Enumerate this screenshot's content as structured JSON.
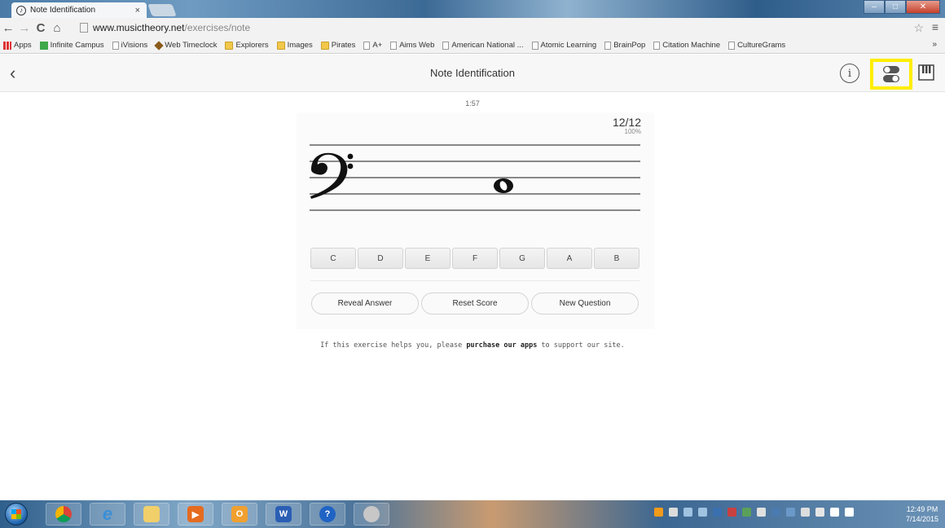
{
  "browser": {
    "tab_title": "Note Identification",
    "tab_close": "×",
    "url_host": "www.musictheory.net",
    "url_path": "/exercises/note",
    "bookmarks": [
      {
        "label": "Apps",
        "icon": "apps-grid"
      },
      {
        "label": "Infinite Campus",
        "icon": "green-square"
      },
      {
        "label": "iVisions",
        "icon": "page"
      },
      {
        "label": "Web Timeclock",
        "icon": "diamond"
      },
      {
        "label": "Explorers",
        "icon": "folder"
      },
      {
        "label": "Images",
        "icon": "folder"
      },
      {
        "label": "Pirates",
        "icon": "folder"
      },
      {
        "label": "A+",
        "icon": "page"
      },
      {
        "label": "Aims Web",
        "icon": "page"
      },
      {
        "label": "American National ...",
        "icon": "page"
      },
      {
        "label": "Atomic Learning",
        "icon": "page"
      },
      {
        "label": "BrainPop",
        "icon": "page"
      },
      {
        "label": "Citation Machine",
        "icon": "page"
      },
      {
        "label": "CultureGrams",
        "icon": "page"
      }
    ],
    "bookmarks_more": "»"
  },
  "app": {
    "title": "Note Identification",
    "back": "‹",
    "info": "i"
  },
  "exercise": {
    "timer": "1:57",
    "score": "12/12",
    "score_percent": "100%",
    "note_answer_choices": [
      "C",
      "D",
      "E",
      "F",
      "G",
      "A",
      "B"
    ],
    "clef": "bass",
    "actions": {
      "reveal": "Reveal Answer",
      "reset": "Reset Score",
      "new": "New Question"
    }
  },
  "footer": {
    "prefix": "If this exercise helps you, please",
    "link": "purchase our apps",
    "suffix": "to support our site."
  },
  "taskbar": {
    "time": "12:49 PM",
    "date": "7/14/2015"
  },
  "colors": {
    "highlight": "#ffee00",
    "header_bg": "#f7f7f7",
    "card_bg": "#fbfbfb"
  }
}
